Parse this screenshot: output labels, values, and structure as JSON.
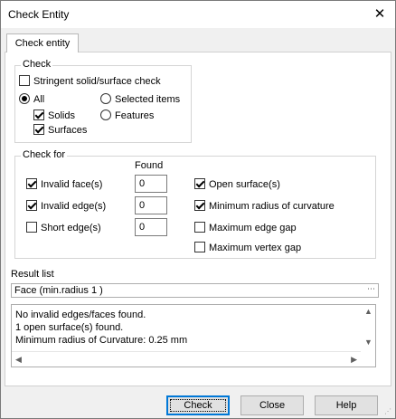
{
  "window": {
    "title": "Check Entity",
    "close_glyph": "✕"
  },
  "tab": {
    "label": "Check entity"
  },
  "check_group": {
    "legend": "Check",
    "stringent": {
      "label": "Stringent solid/surface check",
      "checked": false
    },
    "all": {
      "label": "All",
      "selected": true
    },
    "selected_items": {
      "label": "Selected items",
      "selected": false
    },
    "solids": {
      "label": "Solids",
      "checked": true
    },
    "features": {
      "label": "Features",
      "selected": false
    },
    "surfaces": {
      "label": "Surfaces",
      "checked": true
    }
  },
  "check_for": {
    "legend": "Check for",
    "found_header": "Found",
    "items": [
      {
        "label": "Invalid face(s)",
        "checked": true,
        "found": "0"
      },
      {
        "label": "Invalid edge(s)",
        "checked": true,
        "found": "0"
      },
      {
        "label": "Short edge(s)",
        "checked": false,
        "found": "0"
      }
    ],
    "right_items": [
      {
        "label": "Open surface(s)",
        "checked": true
      },
      {
        "label": "Minimum radius of curvature",
        "checked": true
      },
      {
        "label": "Maximum edge gap",
        "checked": false
      },
      {
        "label": "Maximum vertex gap",
        "checked": false
      }
    ]
  },
  "result_list": {
    "label": "Result list",
    "selected": "Face (min.radius 1 )",
    "lines": [
      "No invalid edges/faces found.",
      "1 open surface(s) found.",
      "Minimum radius of Curvature: 0.25 mm"
    ]
  },
  "buttons": {
    "check": "Check",
    "close": "Close",
    "help": "Help"
  },
  "icons": {
    "close": "close-icon",
    "dropdown": "chevron-down-icon",
    "scroll_up": "scroll-up-icon",
    "scroll_down": "scroll-down-icon",
    "scroll_left": "scroll-left-icon",
    "scroll_right": "scroll-right-icon",
    "grip": "resize-grip-icon"
  },
  "colors": {
    "accent": "#0078d7",
    "window_bg": "#f0f0f0",
    "panel_bg": "#ffffff"
  }
}
